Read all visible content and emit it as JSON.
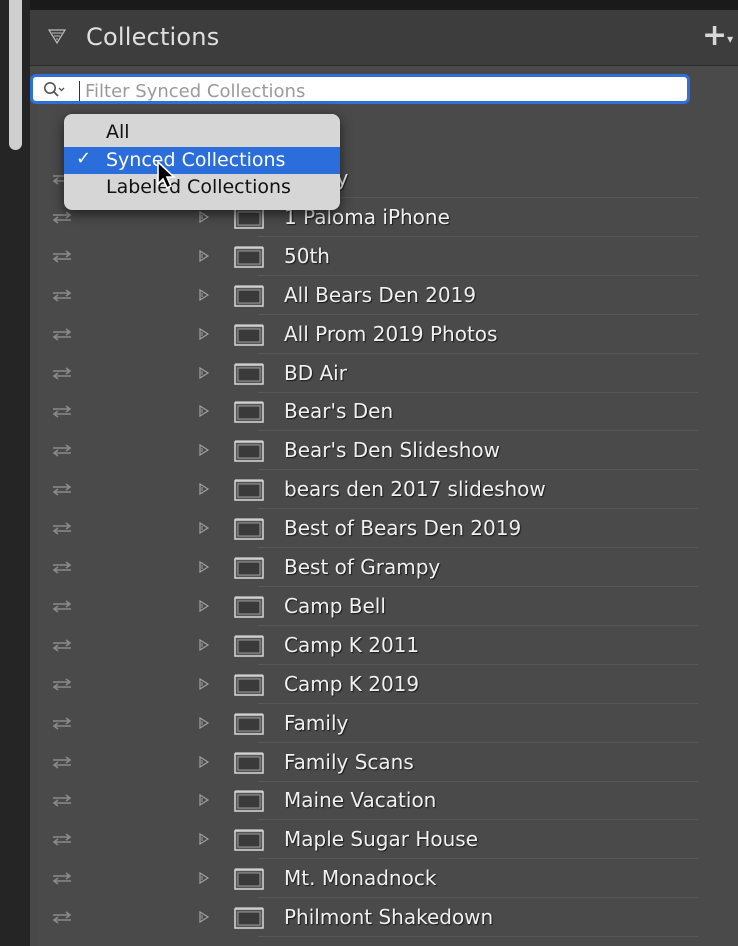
{
  "panel": {
    "title": "Collections",
    "add_label": "+",
    "add_menu_marker": "▾"
  },
  "search": {
    "placeholder": "Filter Synced Collections",
    "value": ""
  },
  "dropdown": {
    "options": [
      {
        "label": "All",
        "selected": false,
        "check": ""
      },
      {
        "label": "Synced Collections",
        "selected": true,
        "check": "✓"
      },
      {
        "label": "Labeled Collections",
        "selected": false,
        "check": ""
      }
    ]
  },
  "collections": [
    "Family",
    "1 Paloma iPhone",
    "50th",
    "All Bears Den 2019",
    "All Prom 2019 Photos",
    "BD Air",
    "Bear's Den",
    "Bear's Den Slideshow",
    "bears den 2017 slideshow",
    "Best of Bears Den 2019",
    "Best of Grampy",
    "Camp Bell",
    "Camp K 2011",
    "Camp K 2019",
    "Family",
    "Family Scans",
    "Maine Vacation",
    "Maple Sugar House",
    "Mt. Monadnock",
    "Philmont Shakedown"
  ],
  "icons": {
    "panel_toggle": "disclosure-triangle-icon",
    "search": "search-icon",
    "sync": "sync-arrows-icon",
    "expand": "expand-arrow-icon",
    "collection": "collection-set-icon",
    "cursor": "mouse-pointer-icon"
  },
  "colors": {
    "panel_bg": "#494949",
    "selection_blue": "#2b6ddb",
    "search_border": "#2f6fd9",
    "menu_bg": "#d6d6d6"
  }
}
